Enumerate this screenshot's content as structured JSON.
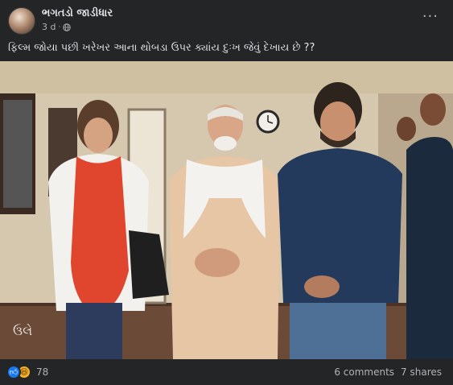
{
  "post": {
    "author": "ભગતડો જાડીધાર",
    "time": "3 d",
    "visibility_icon": "globe-icon",
    "caption": "ફિલ્મ જોયા પછી ખરેખર આના થોબડા ઉપર ક્યાંય દુઃખ જેવું દેખાય છે ??",
    "photo_watermark": "ઉલે",
    "reaction_count": "78",
    "comments": "6 comments",
    "shares": "7 shares",
    "reaction_icons": [
      "like-icon",
      "haha-icon"
    ]
  }
}
